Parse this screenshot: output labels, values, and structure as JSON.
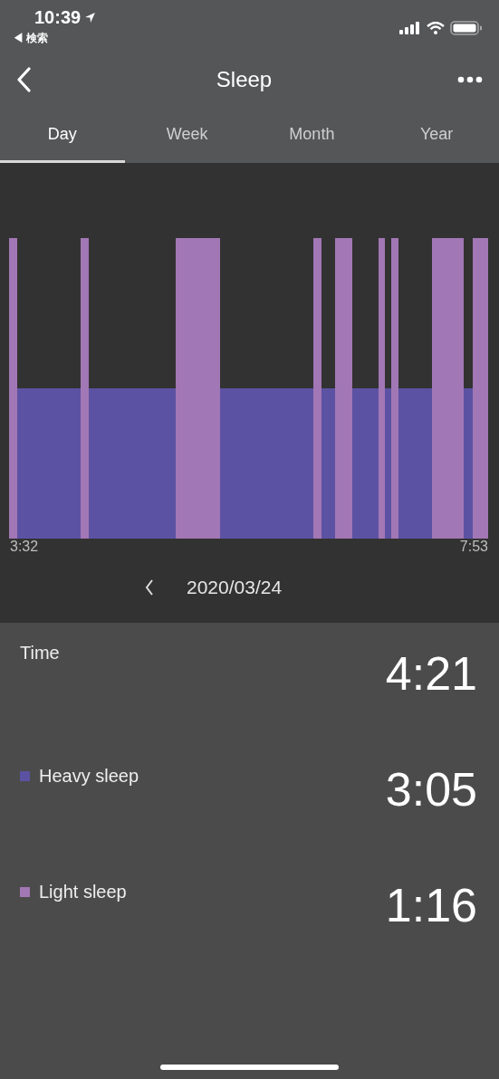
{
  "status_bar": {
    "time": "10:39",
    "back_app": "◀ 検索"
  },
  "nav": {
    "title": "Sleep"
  },
  "tabs": [
    {
      "label": "Day",
      "selected": true
    },
    {
      "label": "Week",
      "selected": false
    },
    {
      "label": "Month",
      "selected": false
    },
    {
      "label": "Year",
      "selected": false
    }
  ],
  "chart": {
    "start_label": "3:32",
    "end_label": "7:53"
  },
  "date_nav": {
    "date": "2020/03/24"
  },
  "summary": {
    "label": "Time",
    "value": "4:21"
  },
  "legend": [
    {
      "label": "Heavy sleep",
      "value": "3:05",
      "color": "#5c52a3"
    },
    {
      "label": "Light sleep",
      "value": "1:16",
      "color": "#a277b5"
    }
  ]
}
